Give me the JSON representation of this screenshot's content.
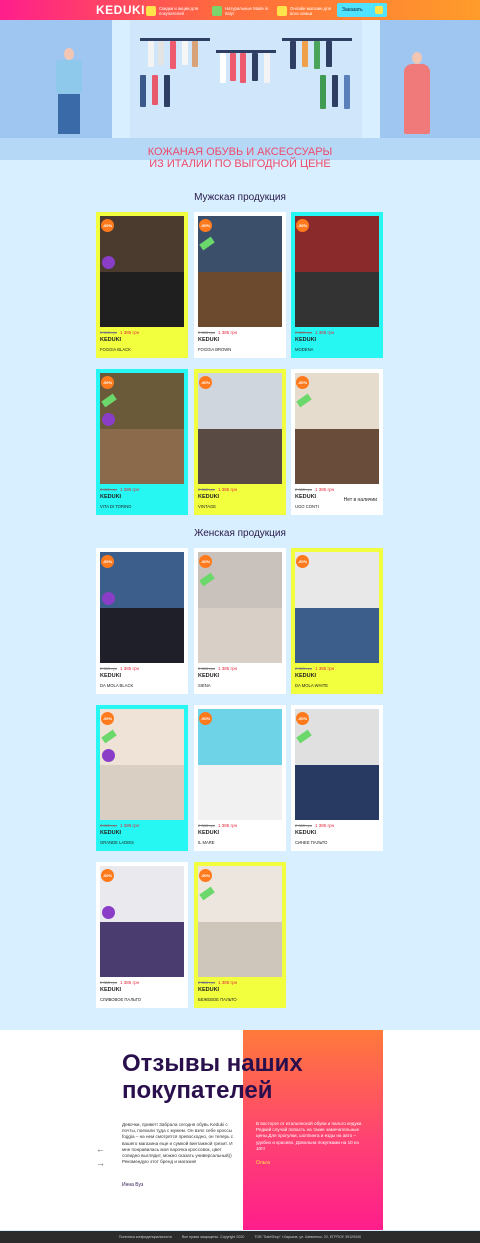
{
  "header": {
    "logo": "KEDUKI",
    "items": [
      {
        "icon": "discount-icon",
        "text": "Скидки и акции для покупателей"
      },
      {
        "icon": "italy-flag-icon",
        "text": "Натуральные Made in Italy!"
      },
      {
        "icon": "store-icon",
        "text": "Онлайн магазин для всех семьи"
      }
    ],
    "order_button": "Заказать",
    "order_icon": "cart-icon"
  },
  "hero": {
    "title_line1": "КОЖАНАЯ ОБУВЬ И АКСЕССУАРЫ",
    "title_line2": "ИЗ ИТАЛИИ ПО ВЫГОДНОЙ ЦЕНЕ"
  },
  "sections": {
    "men": "Мужская продукция",
    "women": "Женская продукция"
  },
  "men_products": [
    {
      "name": "FOGGIA BLACK",
      "old_price": "2 383 грн",
      "price": "1 385 грн",
      "brand": "KEDUKI",
      "badge": "-50%",
      "theme": "yellow"
    },
    {
      "name": "FOGGIA BROWN",
      "old_price": "2 383 грн",
      "price": "1 385 грн",
      "brand": "KEDUKI",
      "badge": "-50%",
      "theme": "white"
    },
    {
      "name": "MODENA",
      "old_price": "2 383 грн",
      "price": "1 385 грн",
      "brand": "KEDUKI",
      "badge": "-50%",
      "theme": "cyan"
    },
    {
      "name": "VITA DI TORINO",
      "old_price": "2 383 грн",
      "price": "1 385 грн",
      "brand": "KEDUKI",
      "badge": "-50%",
      "theme": "cyan"
    },
    {
      "name": "VINTAGE",
      "old_price": "2 383 грн",
      "price": "1 385 грн",
      "brand": "KEDUKI",
      "badge": "-50%",
      "theme": "yellow"
    },
    {
      "name": "UGO CONTI",
      "old_price": "2 383 грн",
      "price": "1 385 грн",
      "brand": "KEDUKI",
      "badge": "-50%",
      "theme": "white",
      "stock": "Нет в наличии"
    }
  ],
  "women_products": [
    {
      "name": "DA MOLA BLACK",
      "old_price": "2 383 грн",
      "price": "1 385 грн",
      "brand": "KEDUKI",
      "badge": "-50%",
      "theme": "white"
    },
    {
      "name": "SIENA",
      "old_price": "2 383 грн",
      "price": "1 385 грн",
      "brand": "KEDUKI",
      "badge": "-50%",
      "theme": "white"
    },
    {
      "name": "DA MOLA WHITE",
      "old_price": "2 383 грн",
      "price": "1 385 грн",
      "brand": "KEDUKI",
      "badge": "-50%",
      "theme": "yellow"
    },
    {
      "name": "GRANDE LADIES",
      "old_price": "2 383 грн",
      "price": "1 385 грн",
      "brand": "KEDUKI",
      "badge": "-50%",
      "theme": "cyan"
    },
    {
      "name": "IL MARE",
      "old_price": "2 383 грн",
      "price": "1 385 грн",
      "brand": "KEDUKI",
      "badge": "-50%",
      "theme": "white"
    },
    {
      "name": "СИНЕЕ ПАЛЬТО",
      "old_price": "2 383 грн",
      "price": "1 385 грн",
      "brand": "KEDUKI",
      "badge": "-50%",
      "theme": "white"
    },
    {
      "name": "СЛИВОВОЕ ПАЛЬТО",
      "old_price": "2 383 грн",
      "price": "1 385 грн",
      "brand": "KEDUKI",
      "badge": "-50%",
      "theme": "white"
    },
    {
      "name": "БЕЖЕВОЕ ПАЛЬТО",
      "old_price": "2 383 грн",
      "price": "1 385 грн",
      "brand": "KEDUKI",
      "badge": "-50%",
      "theme": "yellow"
    }
  ],
  "reviews": {
    "title": "Отзывы наших покупателей",
    "review1": "Девочки, привет! Забрала сегодня обувь Keduki с почты, поехали туда с мужем. Он взял себе кроссы foggia – на нем смотрятся превосходно, он теперь с вашего магазина еще и сумкой винтажной грезит. И мне понравилась моя парочка кроссовок, цвет солидно выглядит, можно сказать универсальный)) Рекомендую этот бренд и магазин!",
    "author1": "Инна Буз",
    "review2": "В восторге от итальянской обуви и пальто кедуки. Редкий случай попасть на такие замечательные цены.Для прогулки, шоппинга и езды на авто – удобно и красиво. Довольна покупками на 10 из 10!!!",
    "author2": "Ольга"
  },
  "footer": {
    "policy": "Политика конфиденциальности",
    "rights": "Все права защищены. Copyright 2020",
    "company": "ТОВ \"SaleShop\" г.Харьков, ул. Шевченко, 20, ЕГРПОУ 39129340"
  },
  "colors": {
    "accent_yellow": "#f2ff3e",
    "accent_cyan": "#27f7f2",
    "price_red": "#e5283c",
    "header_pink": "#ff1e8c",
    "header_orange": "#ff9c2a"
  }
}
